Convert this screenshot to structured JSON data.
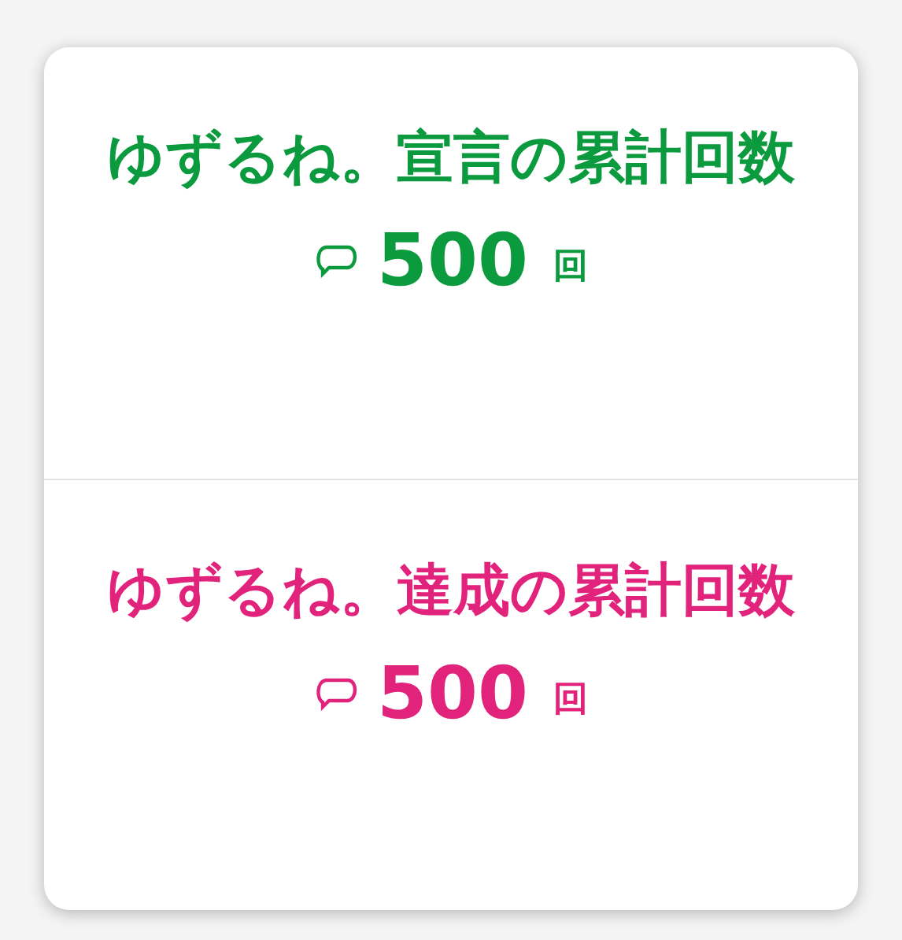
{
  "stats": [
    {
      "title": "ゆずるね。宣言の累計回数",
      "value": "500",
      "unit": "回",
      "color": "#0b9a3e"
    },
    {
      "title": "ゆずるね。達成の累計回数",
      "value": "500",
      "unit": "回",
      "color": "#e2237b"
    }
  ]
}
